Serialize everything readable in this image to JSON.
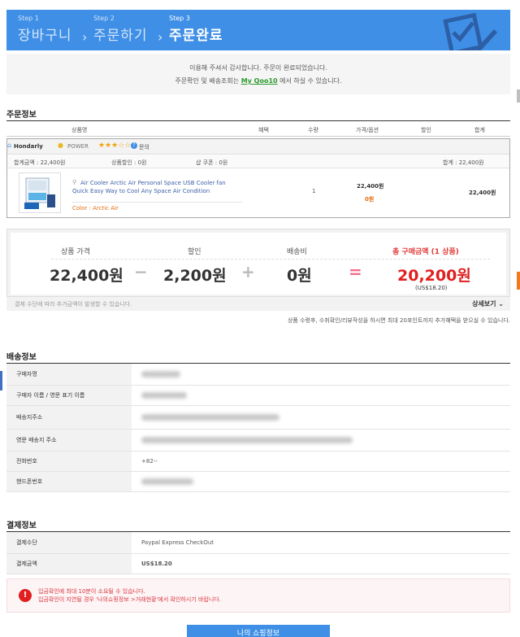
{
  "steps": [
    {
      "num": "Step 1",
      "name": "장바구니"
    },
    {
      "num": "Step 2",
      "name": "주문하기"
    },
    {
      "num": "Step 3",
      "name": "주문완료"
    }
  ],
  "thanks": {
    "line1": "이용해 주셔서 감사합니다. 주문이 완료되었습니다.",
    "line2_pre": "주문확인 및 배송조회는",
    "line2_link": "My Qoo10",
    "line2_post": "에서 하실 수 있습니다."
  },
  "order_info": {
    "title": "주문정보",
    "headers": {
      "product": "상품명",
      "benefit": "혜택",
      "qty": "수량",
      "price_option": "가격/옵션",
      "discount": "할인",
      "total": "합계"
    },
    "seller": {
      "name": "Hondarly",
      "power": "POWER",
      "stars": "★★★☆☆",
      "inquiry": "문의"
    },
    "summary": {
      "amount": "합계금액 : 22,400원",
      "discount": "상품할인 : 0원",
      "coupon": "샵 쿠폰 : 0원",
      "total": "합계 : 22,400원"
    },
    "item": {
      "title": "Air Cooler Arctic Air Personal Space USB Cooler fan Quick Easy Way to Cool Any Space Air Condition",
      "option": "Color : Arctic Air",
      "qty": "1",
      "price": "22,400원",
      "price_discount": "0원",
      "total": "22,400원"
    }
  },
  "calc": {
    "price_label": "상품 가격",
    "price": "22,400원",
    "discount_label": "할인",
    "discount": "2,200원",
    "shipping_label": "배송비",
    "shipping": "0원",
    "total_label": "총 구매금액 (1 상품)",
    "total": "20,200원",
    "usd": "(US$18.20)",
    "op_minus": "−",
    "op_plus": "+",
    "op_eq": "="
  },
  "notes": {
    "payment_note": "결제 수단에 따라 추가금액이 발생할 수 있습니다.",
    "more": "상세보기 ⌄",
    "review_note": "상품 수령후, 수취확인/리뷰작성을 하시면 최대 20포인트까지 추가혜택을 받으실 수 있습니다."
  },
  "shipping_info": {
    "title": "배송정보",
    "rows": [
      {
        "label": "구매자명"
      },
      {
        "label": "구매자 이름 / 영문 표기 이름"
      },
      {
        "label": "배송지주소"
      },
      {
        "label": "영문 배송지 주소"
      },
      {
        "label": "전화번호",
        "value": "+82--"
      },
      {
        "label": "핸드폰번호"
      }
    ]
  },
  "payment_info": {
    "title": "결제정보",
    "method_label": "결제수단",
    "method": "Paypal Express CheckOut",
    "amount_label": "결제금액",
    "amount": "US$18.20"
  },
  "notice": {
    "line1": "입금확인에 최대 10분이 소요될 수 있습니다.",
    "line2": "입금확인이 지연될 경우 '나의쇼핑정보 >거래현황'에서 확인하시기 바랍니다."
  },
  "button": {
    "label": "나의 쇼핑정보"
  },
  "colors": {
    "accent": "#3f8fe6",
    "highlight": "#e02020",
    "option": "#e46d0f",
    "link": "#2e9a2e"
  }
}
